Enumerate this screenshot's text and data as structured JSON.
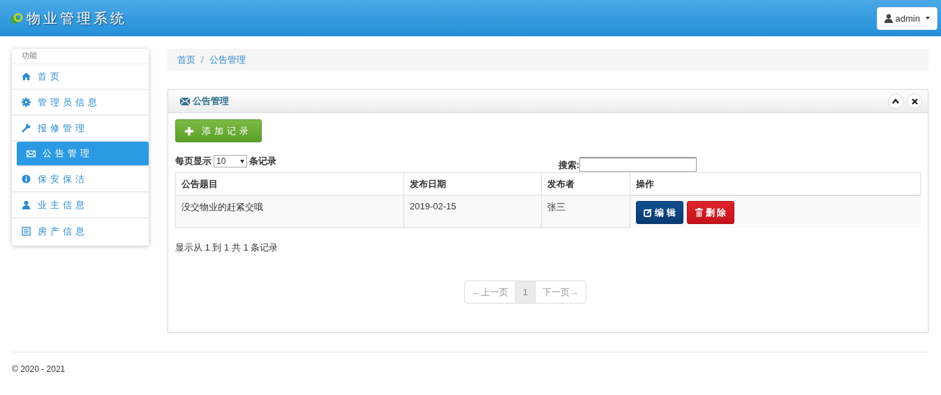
{
  "header": {
    "title": "物业管理系统",
    "user_button": "admin"
  },
  "sidebar": {
    "heading": "功能",
    "items": [
      {
        "label": "首页",
        "selected": false
      },
      {
        "label": "管理员信息",
        "selected": false
      },
      {
        "label": "报修管理",
        "selected": false
      },
      {
        "label": "公告管理",
        "selected": true
      },
      {
        "label": "保安保洁",
        "selected": false
      },
      {
        "label": "业主信息",
        "selected": false
      },
      {
        "label": "房产信息",
        "selected": false
      }
    ]
  },
  "breadcrumb": {
    "separator": "/",
    "items": [
      "首页",
      "公告管理"
    ]
  },
  "panel": {
    "title": "公告管理",
    "add_button": "添加记录",
    "length_prefix": "每页显示",
    "length_value": "10",
    "length_suffix": "条记录",
    "search_label": "搜索:",
    "table": {
      "columns": [
        "公告题目",
        "发布日期",
        "发布者",
        "操作"
      ],
      "rows": [
        {
          "title": "没交物业的赶紧交哦",
          "date": "2019-02-15",
          "author": "张三",
          "edit": "编 辑",
          "delete": "删 除"
        }
      ]
    },
    "info": "显示从 1 到 1 共 1 条记录",
    "pagination": [
      {
        "label": "←上一页",
        "disabled": true,
        "selected": false
      },
      {
        "label": "1",
        "disabled": false,
        "selected": true
      },
      {
        "label": "下一页→",
        "disabled": true,
        "selected": false
      }
    ]
  },
  "footer": "© 2020 - 2021"
}
